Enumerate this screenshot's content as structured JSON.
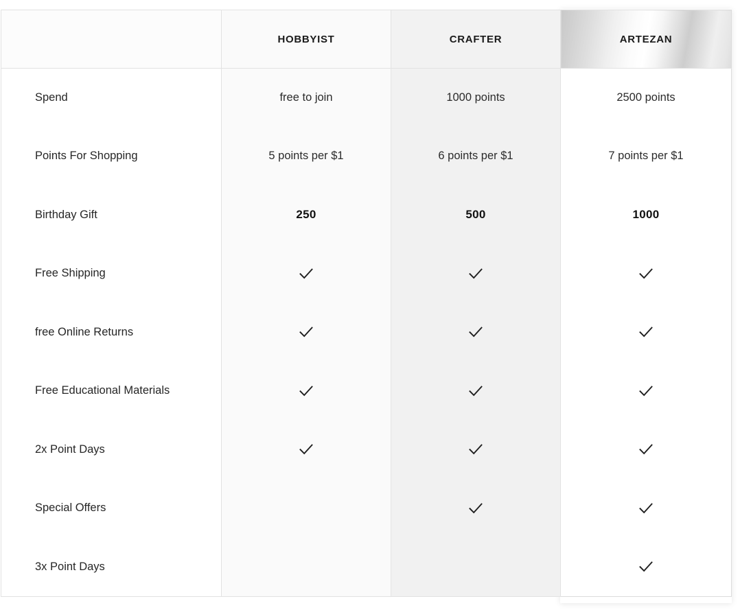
{
  "table": {
    "columns": [
      {
        "id": "feature",
        "label": "",
        "highlighted": false
      },
      {
        "id": "hobbyist",
        "label": "HOBBYIST",
        "highlighted": false
      },
      {
        "id": "crafter",
        "label": "CRAFTER",
        "highlighted": false
      },
      {
        "id": "artezan",
        "label": "ARTEZAN",
        "highlighted": true
      }
    ],
    "rows": [
      {
        "feature": "Spend",
        "hobbyist": {
          "type": "text",
          "value": "free to join",
          "bold": false
        },
        "crafter": {
          "type": "text",
          "value": "1000 points",
          "bold": false
        },
        "artezan": {
          "type": "text",
          "value": "2500 points",
          "bold": false
        }
      },
      {
        "feature": "Points For Shopping",
        "hobbyist": {
          "type": "text",
          "value": "5 points per $1",
          "bold": false
        },
        "crafter": {
          "type": "text",
          "value": "6 points per $1",
          "bold": false
        },
        "artezan": {
          "type": "text",
          "value": "7 points per $1",
          "bold": false
        }
      },
      {
        "feature": "Birthday Gift",
        "hobbyist": {
          "type": "text",
          "value": "250",
          "bold": true
        },
        "crafter": {
          "type": "text",
          "value": "500",
          "bold": true
        },
        "artezan": {
          "type": "text",
          "value": "1000",
          "bold": true
        }
      },
      {
        "feature": "Free Shipping",
        "hobbyist": {
          "type": "check",
          "value": "checkmark-icon"
        },
        "crafter": {
          "type": "check",
          "value": "checkmark-icon"
        },
        "artezan": {
          "type": "check",
          "value": "checkmark-icon"
        }
      },
      {
        "feature": "free Online Returns",
        "hobbyist": {
          "type": "check",
          "value": "checkmark-icon"
        },
        "crafter": {
          "type": "check",
          "value": "checkmark-icon"
        },
        "artezan": {
          "type": "check",
          "value": "checkmark-icon"
        }
      },
      {
        "feature": "Free Educational Materials",
        "hobbyist": {
          "type": "check",
          "value": "checkmark-icon"
        },
        "crafter": {
          "type": "check",
          "value": "checkmark-icon"
        },
        "artezan": {
          "type": "check",
          "value": "checkmark-icon"
        }
      },
      {
        "feature": "2x Point Days",
        "hobbyist": {
          "type": "check",
          "value": "checkmark-icon"
        },
        "crafter": {
          "type": "check",
          "value": "checkmark-icon"
        },
        "artezan": {
          "type": "check",
          "value": "checkmark-icon"
        }
      },
      {
        "feature": "Special Offers",
        "hobbyist": {
          "type": "empty",
          "value": ""
        },
        "crafter": {
          "type": "check",
          "value": "checkmark-icon"
        },
        "artezan": {
          "type": "check",
          "value": "checkmark-icon"
        }
      },
      {
        "feature": "3x Point Days",
        "hobbyist": {
          "type": "empty",
          "value": ""
        },
        "crafter": {
          "type": "empty",
          "value": ""
        },
        "artezan": {
          "type": "check",
          "value": "checkmark-icon"
        }
      }
    ]
  },
  "colors": {
    "text": "#262626",
    "check": "#1f1f1f",
    "border": "#e2e2e2",
    "col_feature_bg": "#ffffff",
    "col_hobbyist_bg": "#fafafa",
    "col_crafter_bg": "#f1f1f1",
    "col_artezan_bg": "#ffffff",
    "artezan_header_metallic_light": "#ffffff",
    "artezan_header_metallic_dark": "#c9c9c9"
  }
}
